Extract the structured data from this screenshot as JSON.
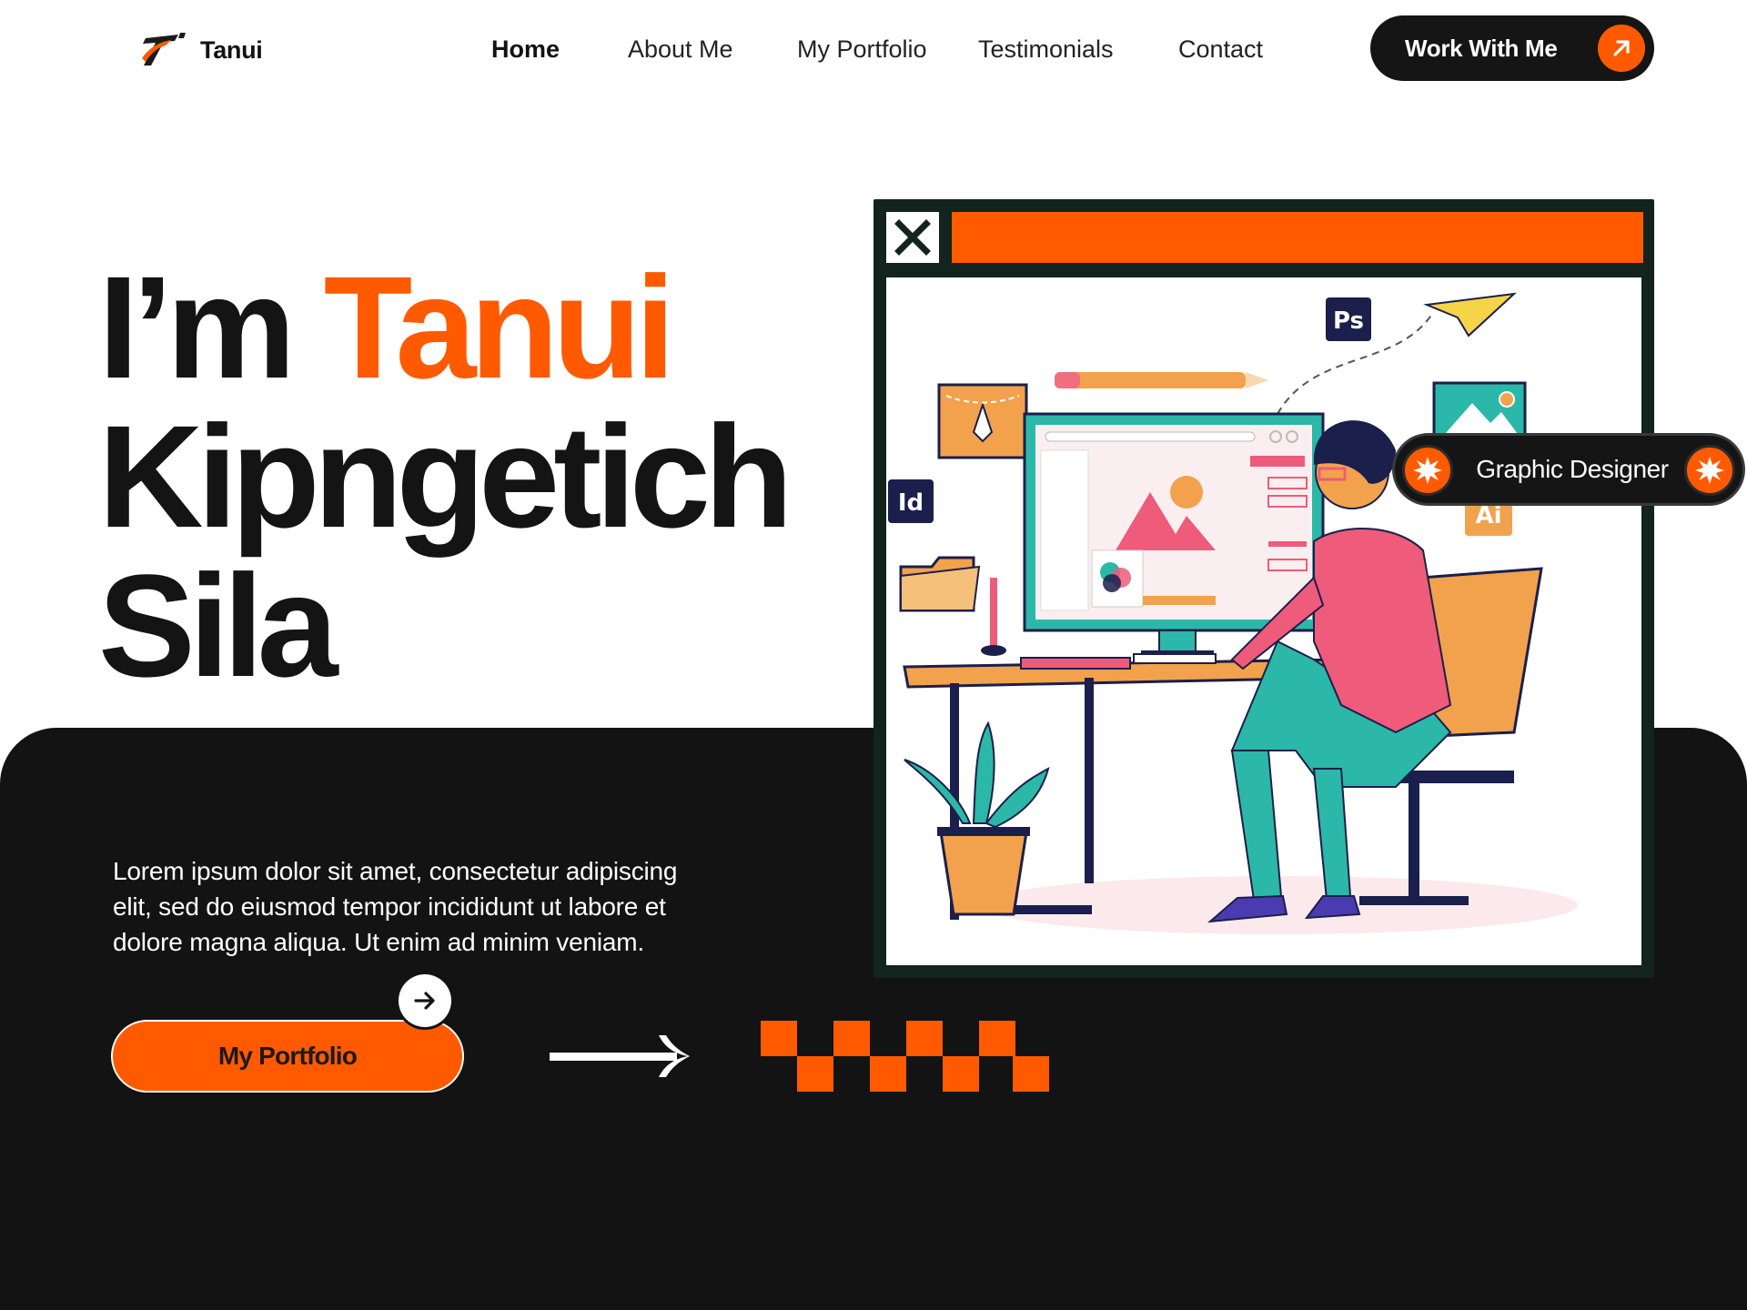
{
  "brand": {
    "name": "Tanui",
    "accent_color": "#ff5a00",
    "dark_color": "#131313"
  },
  "nav": {
    "items": [
      {
        "label": "Home",
        "active": true
      },
      {
        "label": "About Me",
        "active": false
      },
      {
        "label": "My Portfolio",
        "active": false
      },
      {
        "label": "Testimonials",
        "active": false
      },
      {
        "label": "Contact",
        "active": false
      }
    ]
  },
  "cta": {
    "label": "Work With Me",
    "icon": "arrow-up-right-icon"
  },
  "hero": {
    "greeting": "I’m",
    "first_name": "Tanui",
    "middle_name": "Kipngetich",
    "last_name": "Sila",
    "intro": "Lorem ipsum dolor sit amet, consectetur adipiscing elit, sed do eiusmod tempor incididunt ut labore et dolore magna aliqua. Ut enim ad minim veniam.",
    "portfolio_button": "My Portfolio"
  },
  "illustration": {
    "role_badge": "Graphic Designer",
    "app_icons": [
      "Ps",
      "Id",
      "Ai"
    ],
    "close_icon": "close-icon"
  }
}
